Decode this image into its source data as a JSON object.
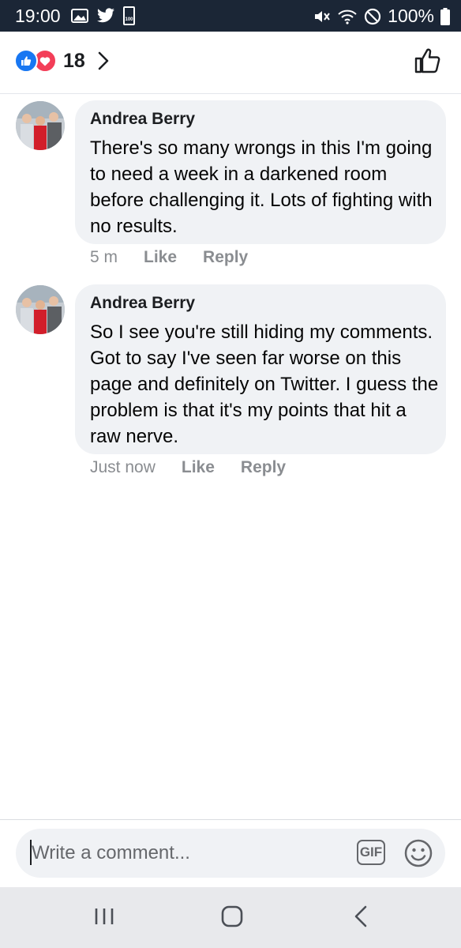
{
  "status_bar": {
    "time": "19:00",
    "battery_percent": "100%",
    "battery_icon_label": "100"
  },
  "post_header": {
    "reaction_count": "18",
    "reaction_icons": [
      "like-icon",
      "love-icon"
    ]
  },
  "comments": [
    {
      "author": "Andrea Berry",
      "text": "There's so many wrongs in this I'm going to need a week in a darkened room before challenging it. Lots of fighting with no results.",
      "time": "5 m",
      "like_label": "Like",
      "reply_label": "Reply"
    },
    {
      "author": "Andrea Berry",
      "text": "So I see you're still hiding my comments. Got to say I've seen far worse on this page and definitely on Twitter. I guess the problem is that it's my points that hit a raw nerve.",
      "time": "Just now",
      "like_label": "Like",
      "reply_label": "Reply"
    }
  ],
  "composer": {
    "placeholder": "Write a comment...",
    "gif_label": "GIF"
  },
  "colors": {
    "status_bar": "#1b2636",
    "like_blue": "#1877f2",
    "love_red": "#f33e58",
    "bubble": "#f0f2f5",
    "meta_gray": "#8a8d91"
  }
}
